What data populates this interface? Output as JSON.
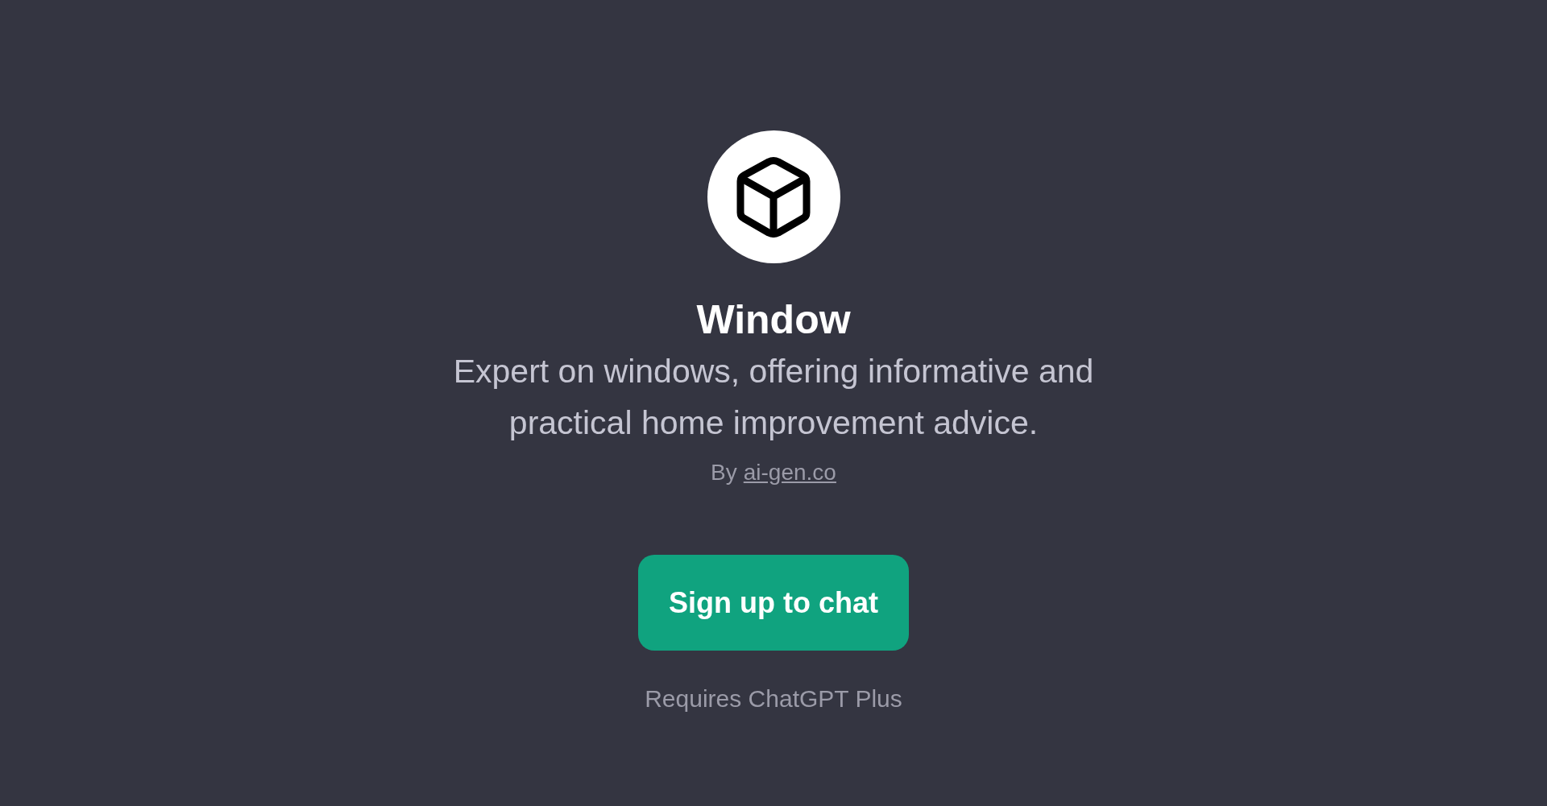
{
  "title": "Window",
  "description": "Expert on windows, offering informative and practical home improvement advice.",
  "byline": {
    "prefix": "By",
    "link": "ai-gen.co"
  },
  "button": "Sign up to chat",
  "note": "Requires ChatGPT Plus"
}
